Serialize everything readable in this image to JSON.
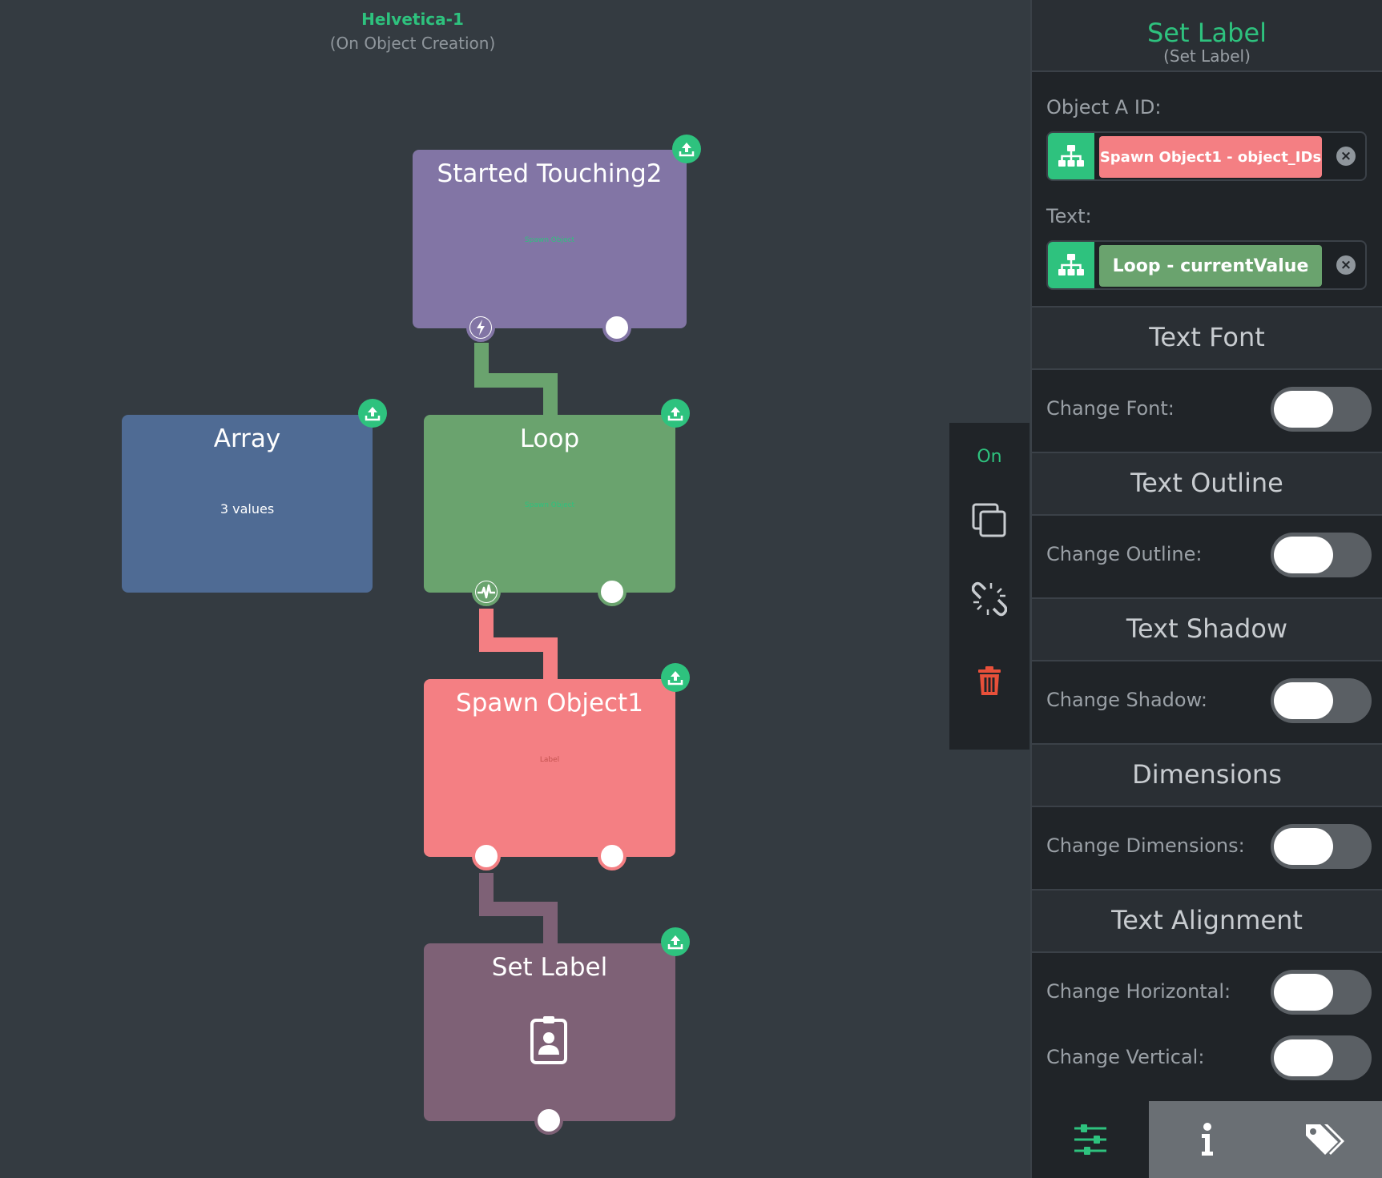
{
  "scene": {
    "object_name": "Helvetica-1",
    "event": "(On Object Creation)"
  },
  "nodes": {
    "started_touching": {
      "title": "Started Touching2",
      "subtitle": "Spawn Object"
    },
    "array": {
      "title": "Array",
      "info": "3 values"
    },
    "loop": {
      "title": "Loop",
      "subtitle": "Spawn Object"
    },
    "spawn_object": {
      "title": "Spawn Object1",
      "subtitle": "Label"
    },
    "set_label": {
      "title": "Set Label"
    }
  },
  "toolstrip": {
    "on_label": "On"
  },
  "panel": {
    "title": "Set Label",
    "subtitle": "(Set Label)",
    "fields": [
      {
        "label": "Object A ID:",
        "value": "Spawn Object1 - object_IDs",
        "color": "#f47f83"
      },
      {
        "label": "Text:",
        "value": "Loop - currentValue",
        "color": "#6aa36e"
      }
    ],
    "sections": [
      {
        "title": "Text Font",
        "rows": [
          {
            "label": "Change Font:",
            "on": false
          }
        ]
      },
      {
        "title": "Text Outline",
        "rows": [
          {
            "label": "Change Outline:",
            "on": false
          }
        ]
      },
      {
        "title": "Text Shadow",
        "rows": [
          {
            "label": "Change Shadow:",
            "on": false
          }
        ]
      },
      {
        "title": "Dimensions",
        "rows": [
          {
            "label": "Change Dimensions:",
            "on": false
          }
        ]
      },
      {
        "title": "Text Alignment",
        "rows": [
          {
            "label": "Change Horizontal:",
            "on": false
          },
          {
            "label": "Change Vertical:",
            "on": false
          }
        ]
      }
    ],
    "tabs": [
      {
        "icon": "sliders-icon",
        "active": false
      },
      {
        "icon": "info-icon",
        "active": true
      },
      {
        "icon": "tags-icon",
        "active": false
      }
    ]
  },
  "colors": {
    "accent": "#2ec27e",
    "started_touching_node": "#8275a5",
    "array_node": "#4f6b94",
    "loop_node": "#6aa36e",
    "spawn_object_node": "#f47f83",
    "set_label_node": "#7e6176",
    "delete": "#e8503a"
  }
}
